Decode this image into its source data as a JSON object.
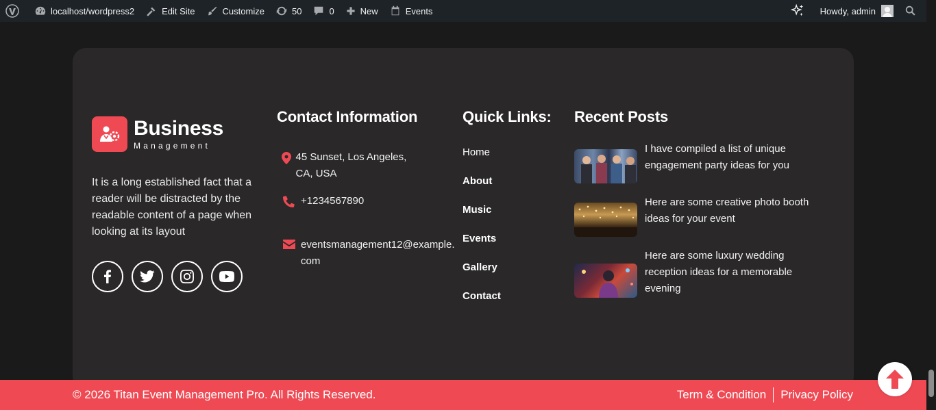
{
  "adminbar": {
    "site": "localhost/wordpress2",
    "edit_site": "Edit Site",
    "customize": "Customize",
    "updates": "50",
    "comments": "0",
    "new": "New",
    "events": "Events",
    "howdy": "Howdy, admin"
  },
  "brand": {
    "name": "Business",
    "tagline": "Management",
    "description": "It is a long established fact that a reader will be distracted by the readable content of a page when looking at its layout"
  },
  "socials": [
    "facebook-icon",
    "twitter-icon",
    "instagram-icon",
    "youtube-icon"
  ],
  "contact": {
    "heading": "Contact Information",
    "address": "45 Sunset, Los Angeles, CA, USA",
    "phone": "+1234567890",
    "email_line1": "eventsmanagement12@example.",
    "email_line2": "com"
  },
  "quick_links": {
    "heading": "Quick Links:",
    "items": [
      "Home",
      "About",
      "Music",
      "Events",
      "Gallery",
      "Contact"
    ]
  },
  "recent_posts": {
    "heading": "Recent Posts",
    "items": [
      "I have compiled a list of unique engagement party ideas for you",
      "Here are some creative photo booth ideas for your event",
      "Here are some luxury wedding reception ideas for a memorable evening"
    ]
  },
  "bottom": {
    "copyright": "© 2026 Titan Event Management Pro. All Rights Reserved.",
    "terms": "Term & Condition",
    "privacy": "Privacy Policy"
  },
  "colors": {
    "accent": "#ef4a54",
    "card": "#2a2828",
    "page": "#1b1a1a",
    "adminbar": "#1d2327"
  }
}
